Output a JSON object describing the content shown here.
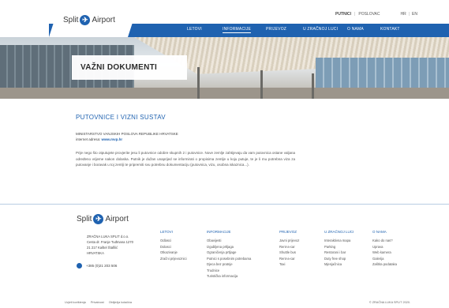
{
  "header": {
    "brand": "Split",
    "brand_suffix": "Airport",
    "top_links": [
      "PUTNICI",
      "POSLOVAC"
    ],
    "languages": [
      "HR",
      "EN"
    ],
    "nav": [
      "LETOVI",
      "INFORMACIJE",
      "PRIJEVOZ",
      "U ZRAČNOJ LUCI",
      "O NAMA",
      "KONTAKT"
    ],
    "active_nav": "INFORMACIJE",
    "accent_color": "#1f62b0"
  },
  "hero": {
    "title": "VAŽNI DOKUMENTI"
  },
  "main": {
    "section_title": "PUTOVNICE I VIZNI SUSTAV",
    "ministry": "MINISTARSTVO VANJSKIH POSLOVA REPUBLIKE HRVATSKE",
    "web_label": "internet adresa:",
    "web_url": "www.mvp.hr",
    "paragraph": "Prije nego što otputujete provjerite jesu li putovnice odobre skupnih 2 i putovnice. Nove zemlje zahtijevaju da vam putovnica ostane valjana određeno vrijeme nakon dolaska. Putnik je dužan unaprijed se informirati o propisima zemlje u koju putuje, te je li mu potrebna viza za putovanje i boravak u toj zemlji te pripremiti svu potrebnu dokumentaciju (putovnica, vizu, osobna iskaznica...)."
  },
  "footer": {
    "brand": "Split",
    "brand_suffix": "Airport",
    "address": [
      "ZRAČNA LUKA SPLIT d.o.o.",
      "Cesta dr. Franje Tuđmana 1270",
      "21 217 Kaštel Štafilić",
      "HRVATSKA"
    ],
    "phone": "+385 (0)21 203 506",
    "columns": [
      {
        "head": "LETOVI",
        "links": [
          "Odlasci",
          "Dolasci",
          "Otkazivanje",
          "Zračni prijevoznici"
        ]
      },
      {
        "head": "INFORMACIJE",
        "links": [
          "Obavijesti",
          "Izgubljena prtljaga",
          "Ograničenja prtljage",
          "Putnici s posebnim potrebama",
          "Djeca bez pratnje",
          "Trudnice",
          "Turistička informacija"
        ]
      },
      {
        "head": "PRIJEVOZ",
        "links": [
          "Javni prijevoz",
          "Rent-a-car",
          "Shuttle bus",
          "Rent-a-car",
          "Taxi"
        ]
      },
      {
        "head": "U ZRAČNOJ LUCI",
        "links": [
          "Interaktivna mapa",
          "Parking",
          "Restorani i bar",
          "Duty free shop",
          "Mjenjačnica"
        ]
      },
      {
        "head": "O NAMA",
        "links": [
          "Kako do nas?",
          "Uprava",
          "Web kamera",
          "Galerija",
          "Zaštita podataka"
        ]
      }
    ],
    "bottom_links": [
      "Uvjeti korištenja",
      "Privatnost",
      "Obilježja kolačića"
    ],
    "copyright": "© ZRAČNA LUKA SPLIT 2020."
  }
}
